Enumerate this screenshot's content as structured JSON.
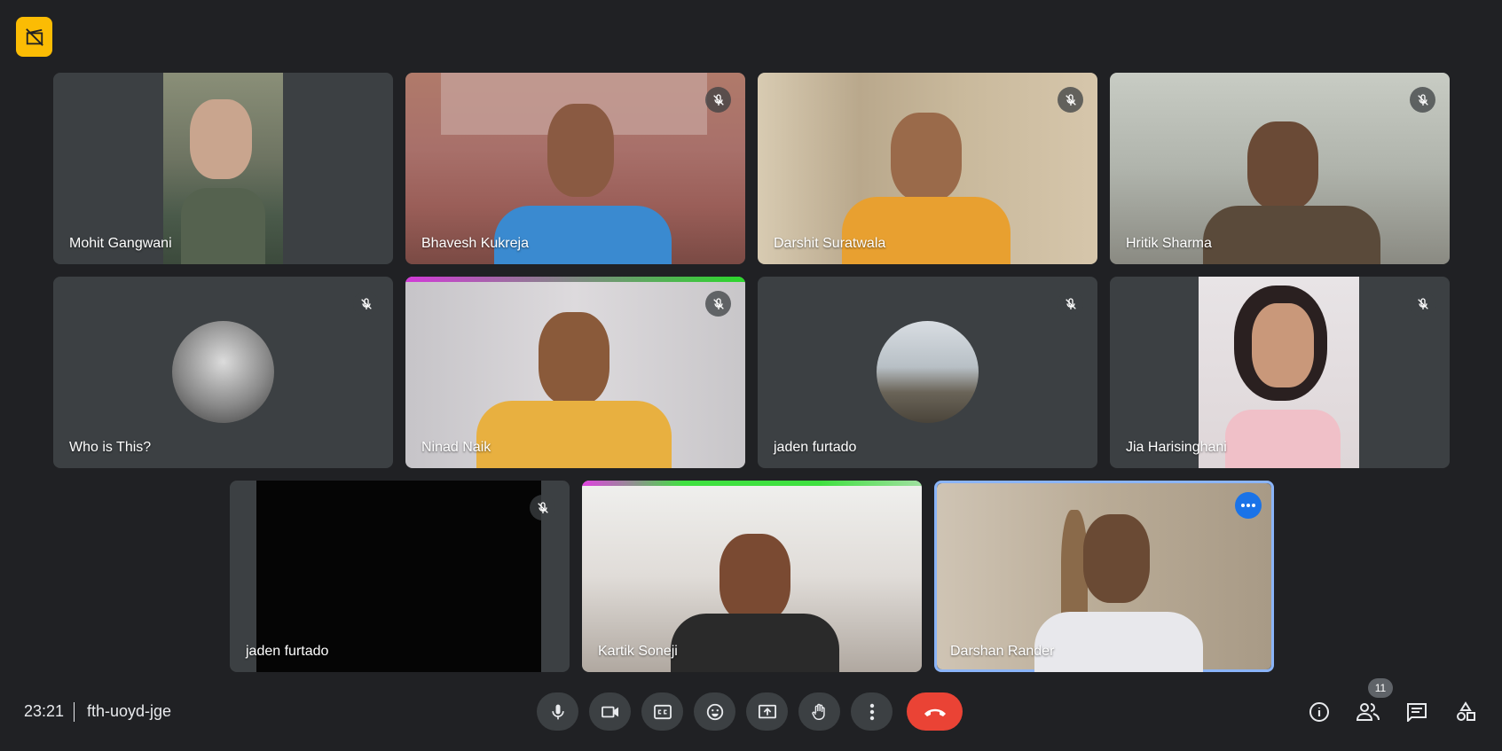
{
  "header": {
    "recording_icon": "no-record-icon",
    "accent": "#fbbc04"
  },
  "participants": [
    {
      "name": "Mohit Gangwani",
      "muted": false
    },
    {
      "name": "Bhavesh Kukreja",
      "muted": true
    },
    {
      "name": "Darshit Suratwala",
      "muted": true
    },
    {
      "name": "Hritik Sharma",
      "muted": true
    },
    {
      "name": "Who is This?",
      "muted": true
    },
    {
      "name": "Ninad Naik",
      "muted": true
    },
    {
      "name": "jaden furtado",
      "muted": true
    },
    {
      "name": "Jia Harisinghani",
      "muted": true
    },
    {
      "name": "jaden furtado",
      "muted": true
    },
    {
      "name": "Kartik Soneji",
      "muted": false
    },
    {
      "name": "Darshan Rander",
      "muted": false,
      "active": true
    }
  ],
  "bottom_bar": {
    "time": "23:21",
    "meeting_code": "fth-uoyd-jge",
    "controls": [
      "mic-icon",
      "camera-icon",
      "captions-icon",
      "emoji-icon",
      "present-icon",
      "raise-hand-icon",
      "more-options-icon",
      "end-call-icon"
    ],
    "people_count": "11",
    "end_color": "#ea4335",
    "active_border": "#8ab4f8"
  }
}
